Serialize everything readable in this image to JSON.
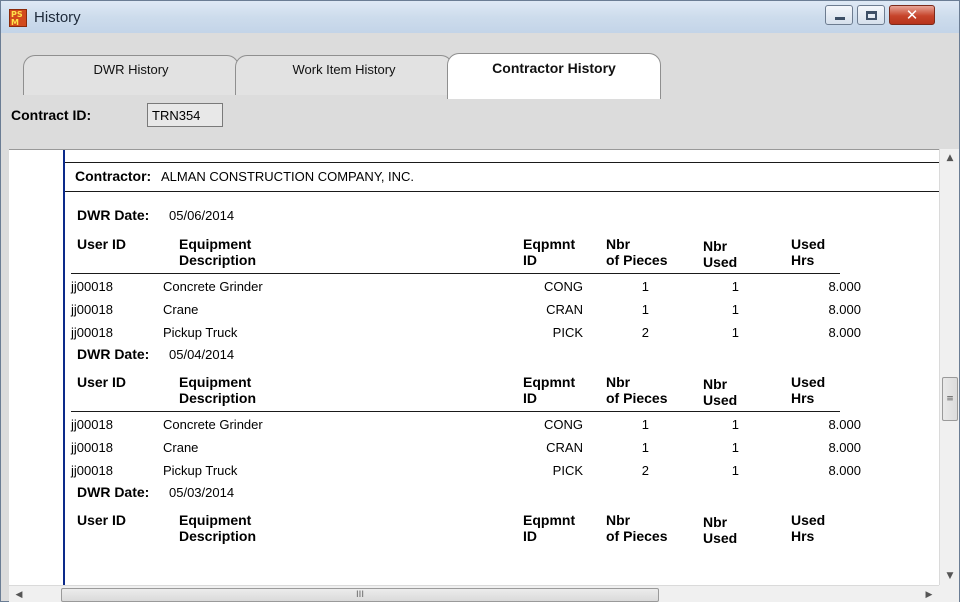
{
  "window": {
    "title": "History",
    "controls": {
      "minimize": "–",
      "maximize": "□",
      "close": "✕"
    }
  },
  "tabs": [
    {
      "label": "DWR History",
      "active": false
    },
    {
      "label": "Work Item History",
      "active": false
    },
    {
      "label": "Contractor History",
      "active": true
    }
  ],
  "contract": {
    "label": "Contract ID:",
    "value": "TRN354"
  },
  "report": {
    "contractor_label": "Contractor:",
    "contractor_name": "ALMAN CONSTRUCTION COMPANY, INC.",
    "dwr_date_label": "DWR Date:",
    "columns": {
      "user_id": "User ID",
      "equipment_l1": "Equipment",
      "equipment_l2": "Description",
      "eqpmnt_l1": "Eqpmnt",
      "eqpmnt_l2": "ID",
      "pieces_l1": "Nbr",
      "pieces_l2": "of Pieces",
      "used_l1": "Nbr",
      "used_l2": "Used",
      "hrs_l1": "Used",
      "hrs_l2": "Hrs"
    },
    "groups": [
      {
        "date": "05/06/2014",
        "rows": [
          {
            "user_id": "jj00018",
            "description": "Concrete Grinder",
            "eqpmnt_id": "CONG",
            "pieces": "1",
            "used": "1",
            "hrs": "8.000"
          },
          {
            "user_id": "jj00018",
            "description": "Crane",
            "eqpmnt_id": "CRAN",
            "pieces": "1",
            "used": "1",
            "hrs": "8.000"
          },
          {
            "user_id": "jj00018",
            "description": "Pickup Truck",
            "eqpmnt_id": "PICK",
            "pieces": "2",
            "used": "1",
            "hrs": "8.000"
          }
        ]
      },
      {
        "date": "05/04/2014",
        "rows": [
          {
            "user_id": "jj00018",
            "description": "Concrete Grinder",
            "eqpmnt_id": "CONG",
            "pieces": "1",
            "used": "1",
            "hrs": "8.000"
          },
          {
            "user_id": "jj00018",
            "description": "Crane",
            "eqpmnt_id": "CRAN",
            "pieces": "1",
            "used": "1",
            "hrs": "8.000"
          },
          {
            "user_id": "jj00018",
            "description": "Pickup Truck",
            "eqpmnt_id": "PICK",
            "pieces": "2",
            "used": "1",
            "hrs": "8.000"
          }
        ]
      },
      {
        "date": "05/03/2014",
        "rows": []
      }
    ]
  },
  "scrollbars": {
    "up": "▲",
    "down": "▼",
    "left": "◀",
    "right": "▶",
    "h_grip": "III",
    "v_grip": "≡"
  }
}
